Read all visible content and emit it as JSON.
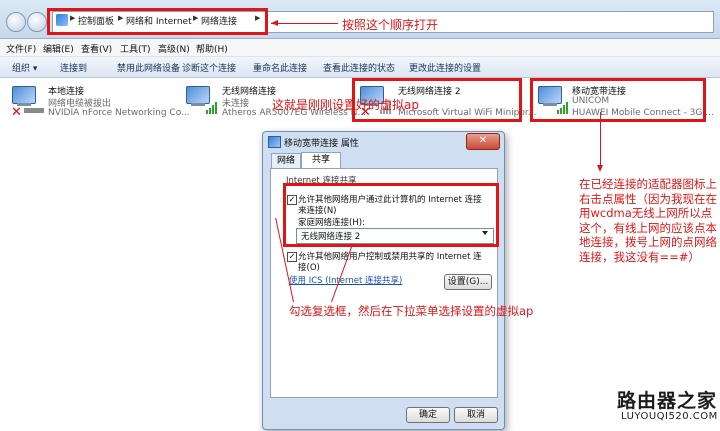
{
  "address": {
    "crumbs": [
      "控制面板",
      "网络和 Internet",
      "网络连接"
    ]
  },
  "annotations": {
    "order": "按照这个顺序打开",
    "virtual_ap": "这就是刚刚设置好的虚拟ap",
    "side_note": "在已经连接的适配器图标上右击点属性（因为我现在在用wcdma无线上网所以点这个，有线上网的应该点本地连接，拨号上网的点网络连接，我这没有==#）",
    "checkbox_hint": "勾选复选框，然后在下拉菜单选择设置的虚拟ap"
  },
  "menu": [
    "文件(F)",
    "编辑(E)",
    "查看(V)",
    "工具(T)",
    "高级(N)",
    "帮助(H)"
  ],
  "toolbar": [
    "组织 ▾",
    "连接到",
    "禁用此网络设备",
    "诊断这个连接",
    "重命名此连接",
    "查看此连接的状态",
    "更改此连接的设置"
  ],
  "adapters": [
    {
      "name": "本地连接",
      "status": "网络电缆被拔出",
      "device": "NVIDIA nForce Networking Co..."
    },
    {
      "name": "无线网络连接",
      "status": "未连接",
      "device": "Atheros AR5007EG Wireless N..."
    },
    {
      "name": "无线网络连接 2",
      "status": "",
      "device": "Microsoft Virtual WiFi Minipor..."
    },
    {
      "name": "移动宽带连接",
      "status": "UNICOM",
      "device": "HUAWEI Mobile Connect - 3G ..."
    }
  ],
  "dialog": {
    "title": "移动宽带连接 属性",
    "close": "✕",
    "tabs": [
      "网络",
      "共享"
    ],
    "group_label": "Internet 连接共享",
    "allow_share_line1": "允许其他网络用户通过此计算机的 Internet 连接",
    "allow_share_line2": "来连接(N)",
    "home_conn_label": "家庭网络连接(H):",
    "home_conn_value": "无线网络连接 2",
    "allow_control_line1": "允许其他网络用户控制或禁用共享的 Internet 连",
    "allow_control_line2": "接(O)",
    "ics_link": "使用 ICS (Internet 连接共享)",
    "settings_btn": "设置(G)...",
    "ok_btn": "确定",
    "cancel_btn": "取消"
  },
  "logo": {
    "main": "路由器之家",
    "sub": "LUYOUQI520.COM"
  }
}
